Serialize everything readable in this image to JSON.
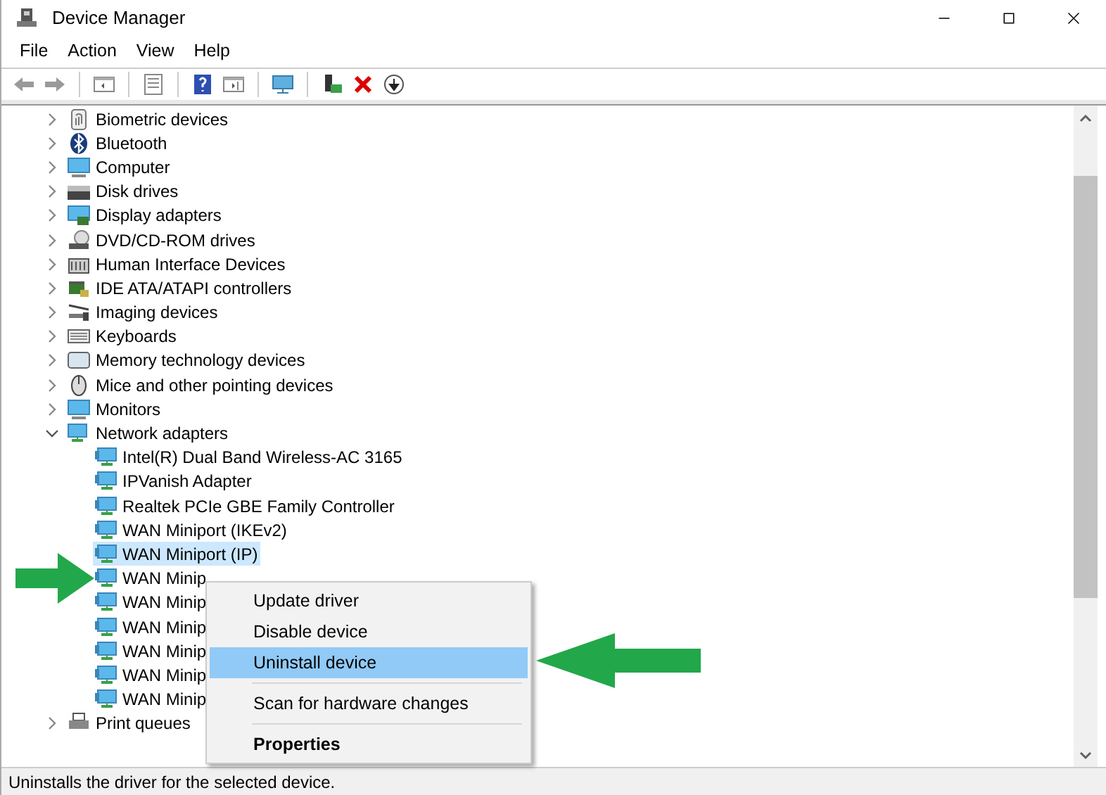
{
  "window": {
    "title": "Device Manager"
  },
  "menu_bar": [
    "File",
    "Action",
    "View",
    "Help"
  ],
  "tree": [
    {
      "label": "Biometric devices",
      "expanded": false
    },
    {
      "label": "Bluetooth",
      "expanded": false
    },
    {
      "label": "Computer",
      "expanded": false
    },
    {
      "label": "Disk drives",
      "expanded": false
    },
    {
      "label": "Display adapters",
      "expanded": false
    },
    {
      "label": "DVD/CD-ROM drives",
      "expanded": false
    },
    {
      "label": "Human Interface Devices",
      "expanded": false
    },
    {
      "label": "IDE ATA/ATAPI controllers",
      "expanded": false
    },
    {
      "label": "Imaging devices",
      "expanded": false
    },
    {
      "label": "Keyboards",
      "expanded": false
    },
    {
      "label": "Memory technology devices",
      "expanded": false
    },
    {
      "label": "Mice and other pointing devices",
      "expanded": false
    },
    {
      "label": "Monitors",
      "expanded": false
    },
    {
      "label": "Network adapters",
      "expanded": true,
      "children": [
        {
          "label": "Intel(R) Dual Band Wireless-AC 3165",
          "selected": false
        },
        {
          "label": "IPVanish Adapter",
          "selected": false
        },
        {
          "label": "Realtek PCIe GBE Family Controller",
          "selected": false
        },
        {
          "label": "WAN Miniport (IKEv2)",
          "selected": false
        },
        {
          "label": "WAN Miniport (IP)",
          "selected": true
        },
        {
          "label": "WAN Minip",
          "selected": false
        },
        {
          "label": "WAN Minip",
          "selected": false
        },
        {
          "label": "WAN Minip",
          "selected": false
        },
        {
          "label": "WAN Minip",
          "selected": false
        },
        {
          "label": "WAN Minip",
          "selected": false
        },
        {
          "label": "WAN Minip",
          "selected": false
        }
      ]
    },
    {
      "label": "Print queues",
      "expanded": false
    }
  ],
  "context_menu": [
    {
      "kind": "item",
      "label": "Update driver",
      "highlighted": false,
      "bold": false
    },
    {
      "kind": "item",
      "label": "Disable device",
      "highlighted": false,
      "bold": false
    },
    {
      "kind": "item",
      "label": "Uninstall device",
      "highlighted": true,
      "bold": false
    },
    {
      "kind": "separator"
    },
    {
      "kind": "item",
      "label": "Scan for hardware changes",
      "highlighted": false,
      "bold": false
    },
    {
      "kind": "separator"
    },
    {
      "kind": "item",
      "label": "Properties",
      "highlighted": false,
      "bold": true
    }
  ],
  "status_bar": "Uninstalls the driver for the selected device."
}
